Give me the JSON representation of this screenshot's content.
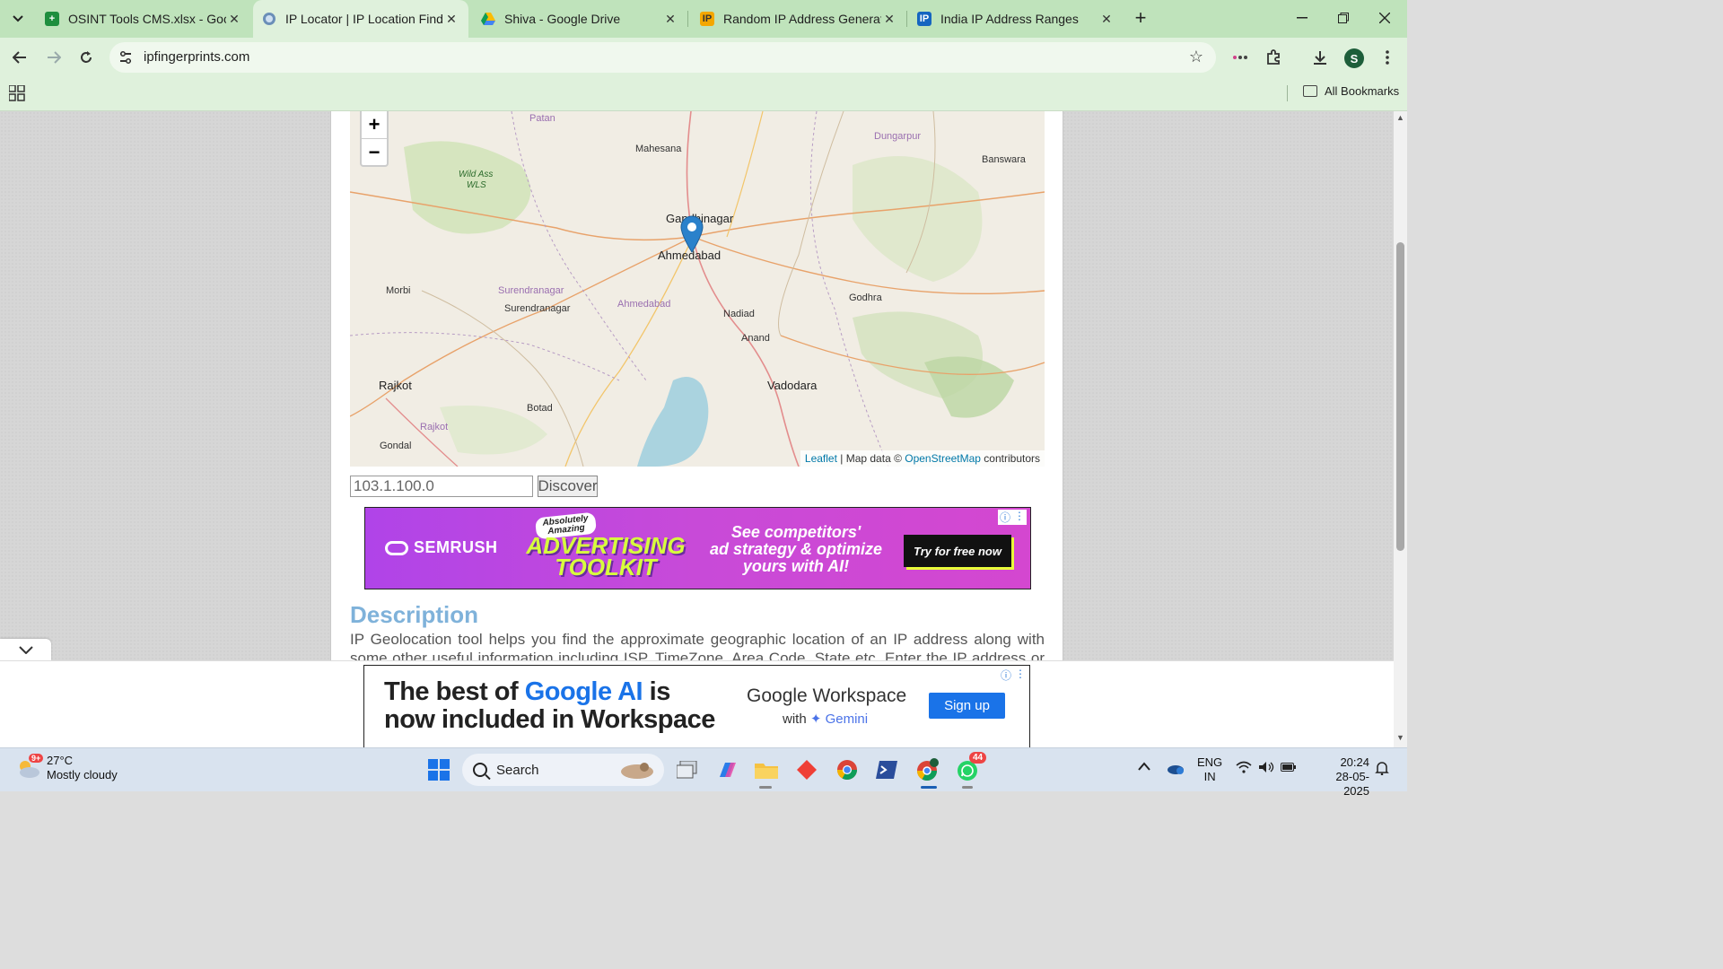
{
  "tabs": [
    {
      "title": "OSINT Tools CMS.xlsx - Google",
      "icon": "sheets-icon",
      "active": false
    },
    {
      "title": "IP Locator | IP Location Finder |",
      "icon": "globe-icon",
      "active": true
    },
    {
      "title": "Shiva - Google Drive",
      "icon": "drive-icon",
      "active": false
    },
    {
      "title": "Random IP Address Generator,",
      "icon": "ip-icon",
      "active": false
    },
    {
      "title": "India IP Address Ranges",
      "icon": "ip-icon",
      "active": false
    }
  ],
  "address_bar": {
    "url": "ipfingerprints.com"
  },
  "profile": {
    "initial": "S"
  },
  "bookmarks": {
    "all_label": "All Bookmarks"
  },
  "map": {
    "zoom_in": "+",
    "zoom_out": "−",
    "places": {
      "patan": "Patan",
      "mahesana": "Mahesana",
      "dungarpur": "Dungarpur",
      "banswara": "Banswara",
      "wild_ass_1": "Wild Ass",
      "wild_ass_2": "WLS",
      "gandhinagar": "Gandhinagar",
      "ahmedabad": "Ahmedabad",
      "morbi": "Morbi",
      "surendranagar_district": "Surendranagar",
      "surendranagar": "Surendranagar",
      "ahmedabad_district": "Ahmedabad",
      "nadiad": "Nadiad",
      "godhra": "Godhra",
      "anand": "Anand",
      "rajkot": "Rajkot",
      "botad": "Botad",
      "vadodara": "Vadodara",
      "rajkot_district": "Rajkot",
      "gondal": "Gondal"
    },
    "attribution": {
      "leaflet": "Leaflet",
      "sep": " | Map data © ",
      "osm": "OpenStreetMap",
      "tail": " contributors"
    }
  },
  "lookup": {
    "ip_value": "103.1.100.0",
    "button_label": "Discover"
  },
  "ad_semrush": {
    "brand": "SEMRUSH",
    "badge_line1": "Absolutely",
    "badge_line2": "Amazing",
    "headline_line1": "ADVERTISING",
    "headline_line2": "TOOLKIT",
    "pitch_line1": "See competitors'",
    "pitch_line2": "ad strategy & optimize",
    "pitch_line3": "yours with AI!",
    "cta": "Try for free now"
  },
  "description": {
    "title": "Description",
    "text": "IP Geolocation tool helps you find the approximate geographic location of an IP address along with some other useful information including ISP, TimeZone, Area Code, State etc. Enter the IP address or the host"
  },
  "ad_google": {
    "line1_a": "The best of ",
    "line1_b": "Google AI",
    "line1_c": " is",
    "line2": "now included in Workspace",
    "product": "Google Workspace",
    "with": "with ",
    "gemini": "✦ Gemini",
    "cta": "Sign up"
  },
  "taskbar": {
    "weather_temp": "27°C",
    "weather_desc": "Mostly cloudy",
    "weather_badge": "9+",
    "search_label": "Search",
    "whatsapp_badge": "44",
    "lang_1": "ENG",
    "lang_2": "IN",
    "time": "20:24",
    "date": "28-05-2025"
  },
  "colors": {
    "chrome_tab_bar": "#bfe3bb",
    "chrome_toolbar": "#dff1dc",
    "link_blue": "#0078a8",
    "heading_blue": "#7fb2da"
  }
}
